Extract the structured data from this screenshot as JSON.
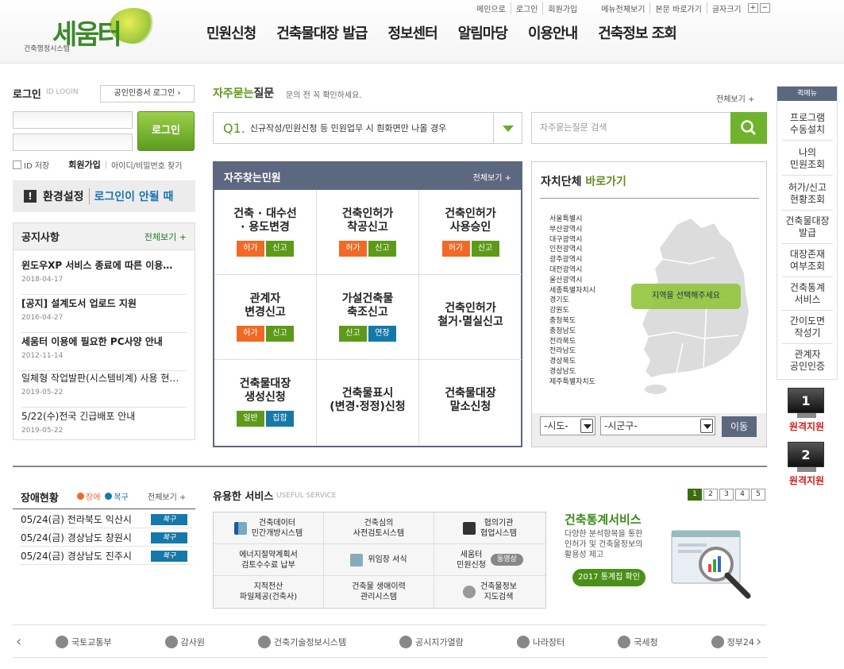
{
  "header": {
    "logo_text": "세움터",
    "logo_sub": "건축행정시스템",
    "util_links": [
      "메인으로",
      "로그인",
      "회원가입"
    ],
    "util_links2": [
      "메뉴전체보기",
      "본문 바로가기",
      "글자크기"
    ],
    "font_plus": "+",
    "font_minus": "−",
    "gnb": [
      "민원신청",
      "건축물대장 발급",
      "정보센터",
      "알림마당",
      "이용안내",
      "건축정보 조회"
    ]
  },
  "login": {
    "title": "로그인",
    "sub": "ID LOGIN",
    "cert_button": "공인인증서 로그인 ›",
    "button": "로그인",
    "save_id": "ID 저장",
    "join": "회원가입",
    "find": "아이디/비밀번호 찾기",
    "env": "환경설정",
    "env_help": "로그인이 안될 때"
  },
  "notice": {
    "title": "공지사항",
    "more": "전체보기 +",
    "items": [
      {
        "title": "윈도우XP 서비스 종료에 따른 이용…",
        "date": "2018-04-17"
      },
      {
        "title": "[공지] 설계도서 업로드 지원",
        "date": "2016-04-27"
      },
      {
        "title": "세움터 이용에 필요한 PC사양 안내",
        "date": "2012-11-14"
      },
      {
        "title": "일체형 작업발판(시스템비계) 사용 현…",
        "date": "2019-05-22"
      },
      {
        "title": "5/22(수)전국 긴급배포 안내",
        "date": "2019-05-22"
      }
    ]
  },
  "faq": {
    "title_green": "자주묻는",
    "title_rest": "질문",
    "sub": "문의 전 꼭 확인하세요.",
    "more": "전체보기 +",
    "q_num": "Q1.",
    "q_text": "신규작성/민원신청 등 민원업무 시 흰화면만 나올 경우",
    "search_placeholder": "자주묻는질문 검색"
  },
  "civil": {
    "title": "자주찾는민원",
    "more": "전체보기 +",
    "cells": [
      {
        "l1": "건축 · 대수선",
        "l2": "· 용도변경",
        "tags": [
          "허가",
          "신고"
        ]
      },
      {
        "l1": "건축인허가",
        "l2": "착공신고",
        "tags": [
          "허가",
          "신고"
        ]
      },
      {
        "l1": "건축인허가",
        "l2": "사용승인",
        "tags": [
          "허가",
          "신고"
        ]
      },
      {
        "l1": "관계자",
        "l2": "변경신고",
        "tags": [
          "허가",
          "신고"
        ]
      },
      {
        "l1": "가설건축물",
        "l2": "축조신고",
        "tags": [
          "신고",
          "연장"
        ]
      },
      {
        "l1": "건축인허가",
        "l2": "철거·멸실신고",
        "tags": []
      },
      {
        "l1": "건축물대장",
        "l2": "생성신청",
        "tags": [
          "일반",
          "집합"
        ]
      },
      {
        "l1": "건축물표시",
        "l2": "(변경·정정)신청",
        "tags": []
      },
      {
        "l1": "건축물대장",
        "l2": "말소신청",
        "tags": []
      }
    ]
  },
  "region": {
    "title_black": "자치단체",
    "title_green": " 바로가기",
    "list": [
      "서울특별시",
      "부산광역시",
      "대구광역시",
      "인천광역시",
      "광주광역시",
      "대전광역시",
      "울산광역시",
      "세종특별자치시",
      "경기도",
      "강원도",
      "충청북도",
      "충청남도",
      "전라북도",
      "전라남도",
      "경상북도",
      "경상남도",
      "제주특별자치도"
    ],
    "map_label": "지역을 선택해주세요",
    "select_sido": "-시도-",
    "select_sigungu": "-시군구-",
    "move": "이동"
  },
  "quick": {
    "title": "퀵메뉴",
    "items": [
      [
        "프로그램",
        "수동설치"
      ],
      [
        "나의",
        "민원조회"
      ],
      [
        "허가/신고",
        "현황조회"
      ],
      [
        "건축물대장",
        "발급"
      ],
      [
        "대장존재",
        "여부조회"
      ],
      [
        "건축통계",
        "서비스"
      ],
      [
        "간이도면",
        "작성기"
      ],
      [
        "관계자",
        "공인인증"
      ]
    ],
    "remote1_num": "1",
    "remote2_num": "2",
    "remote_label": "원격지원"
  },
  "outage": {
    "title": "장애현황",
    "legend_fault": "장애",
    "legend_recover": "복구",
    "more": "전체보기 +",
    "rows": [
      {
        "text": "05/24(금) 전라북도 익산시",
        "status": "복구"
      },
      {
        "text": "05/24(금) 경상남도 창원시",
        "status": "복구"
      },
      {
        "text": "05/24(금) 경상남도 진주시",
        "status": "복구"
      }
    ],
    "colors": {
      "fault": "#f06a26",
      "recover": "#1678a8"
    }
  },
  "useful": {
    "title": "유용한 서비스",
    "sub": "USEFUL SERVICE",
    "pages": [
      "1",
      "2",
      "3",
      "4",
      "5"
    ],
    "cells": [
      {
        "l1": "건축데이터",
        "l2": "민간개방시스템"
      },
      {
        "l1": "건축심의",
        "l2": "사전검토시스템"
      },
      {
        "l1": "협의기관",
        "l2": "협업시스템"
      },
      {
        "l1": "에너지절약계획서",
        "l2": "검토수수료 납부"
      },
      {
        "l1": "위임장 서식",
        "l2": ""
      },
      {
        "l1": "세움터",
        "l2": "민원신청"
      },
      {
        "l1": "지적전산",
        "l2": "파일제공(건축사)"
      },
      {
        "l1": "건축물 생애이력",
        "l2": "관리시스템"
      },
      {
        "l1": "건축물정보",
        "l2": "지도검색"
      }
    ],
    "video_badge": "동영상",
    "stat_title": "건축통계서비스",
    "stat_desc": "다양한 분석항목을 통한 인허가 및 건축물정보의 활용성 제고",
    "stat_button": "2017 통계집 확인"
  },
  "partners": [
    "국토교통부",
    "감사원",
    "건축기술정보시스템",
    "공시지가열람",
    "나라장터",
    "국세청",
    "정부24"
  ],
  "colors": {
    "accent": "#6fb32d",
    "navy": "#5c6880",
    "orange": "#f06a26",
    "blue": "#1678a8",
    "red": "#d31c1c"
  }
}
